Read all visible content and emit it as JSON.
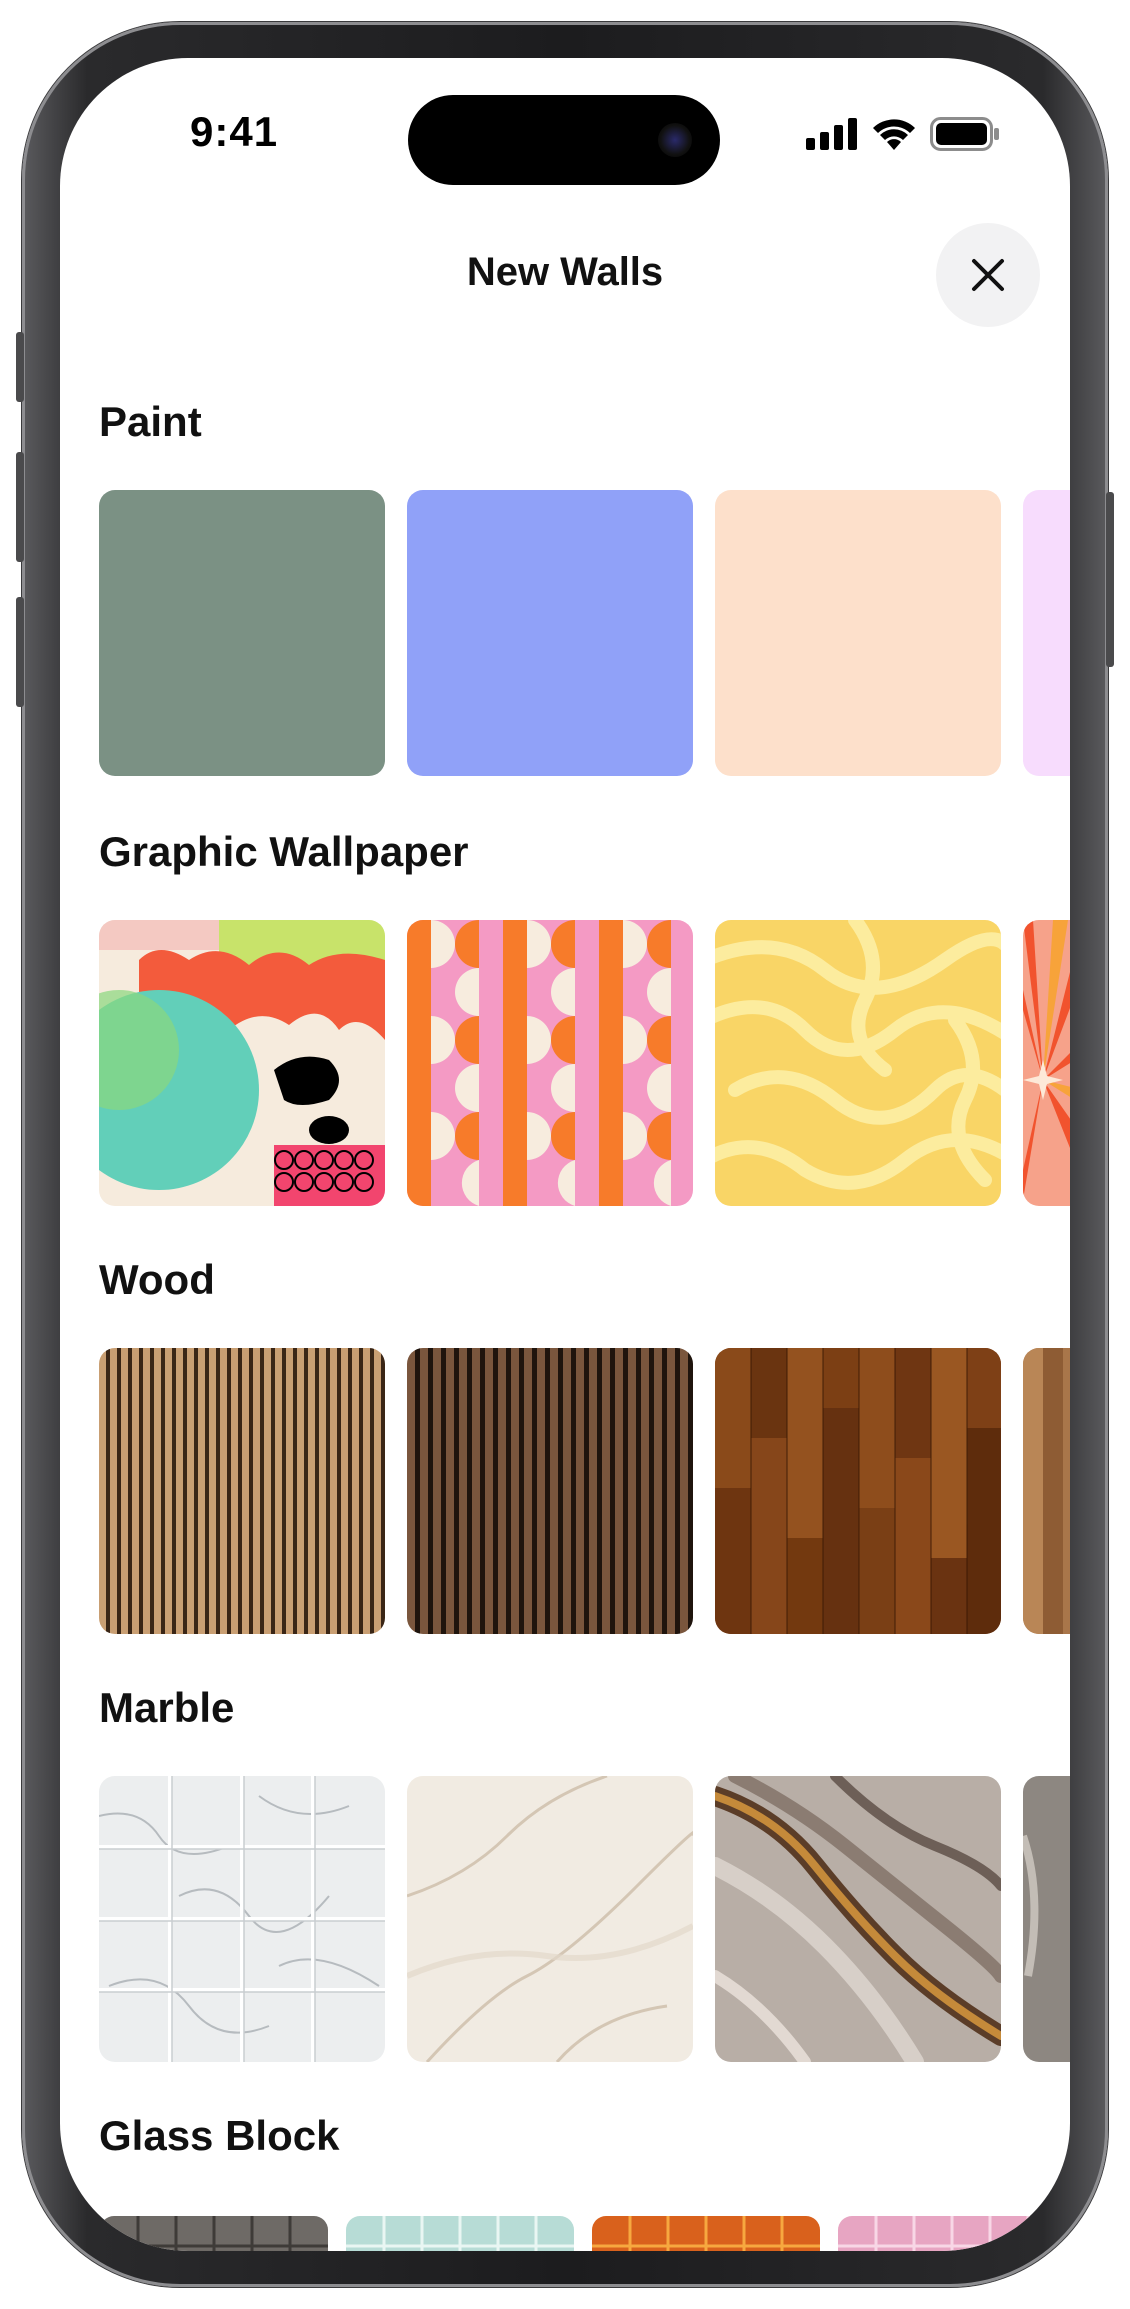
{
  "status_bar": {
    "time": "9:41"
  },
  "header": {
    "title": "New Walls"
  },
  "sections": [
    {
      "title": "Paint"
    },
    {
      "title": "Graphic Wallpaper"
    },
    {
      "title": "Wood"
    },
    {
      "title": "Marble"
    },
    {
      "title": "Glass Block"
    }
  ],
  "paint_colors": [
    "#7b9184",
    "#90a1f8",
    "#fde0cb",
    "#f7dcfd"
  ]
}
